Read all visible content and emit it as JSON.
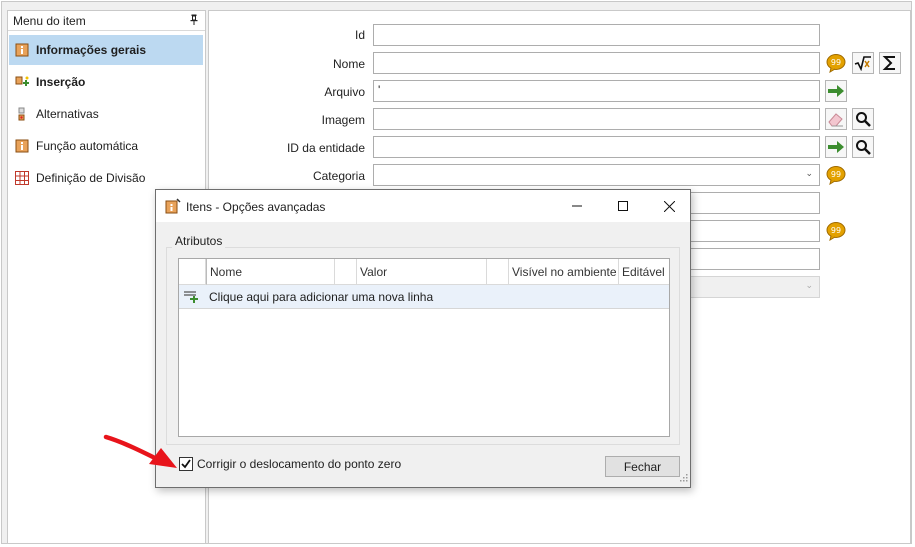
{
  "sidebar": {
    "title": "Menu do item",
    "pin_icon": "pin-icon",
    "items": [
      {
        "label": "Informações gerais",
        "icon": "item-info-icon",
        "active": true
      },
      {
        "label": "Inserção",
        "icon": "insertion-icon"
      },
      {
        "label": "Alternativas",
        "icon": "alternatives-icon"
      },
      {
        "label": "Função automática",
        "icon": "auto-function-icon"
      },
      {
        "label": "Definição de Divisão",
        "icon": "division-grid-icon"
      }
    ]
  },
  "form": {
    "fields": [
      {
        "label": "Id",
        "value": ""
      },
      {
        "label": "Nome",
        "value": ""
      },
      {
        "label": "Arquivo",
        "value": "'"
      },
      {
        "label": "Imagem",
        "value": ""
      },
      {
        "label": "ID da entidade",
        "value": ""
      },
      {
        "label": "Categoria",
        "value": ""
      }
    ]
  },
  "dialog": {
    "title": "Itens - Opções avançadas",
    "group_label": "Atributos",
    "columns": [
      "Nome",
      "Valor",
      "Visível no ambiente",
      "Editável"
    ],
    "new_row_text": "Clique aqui para adicionar uma nova linha",
    "checkbox_label": "Corrigir o deslocamento do ponto zero",
    "checkbox_checked": true,
    "close_label": "Fechar"
  },
  "colors": {
    "active_item": "#bcd9f1",
    "arrow_green": "#3c8d2f",
    "annotation_red": "#e8141b"
  }
}
